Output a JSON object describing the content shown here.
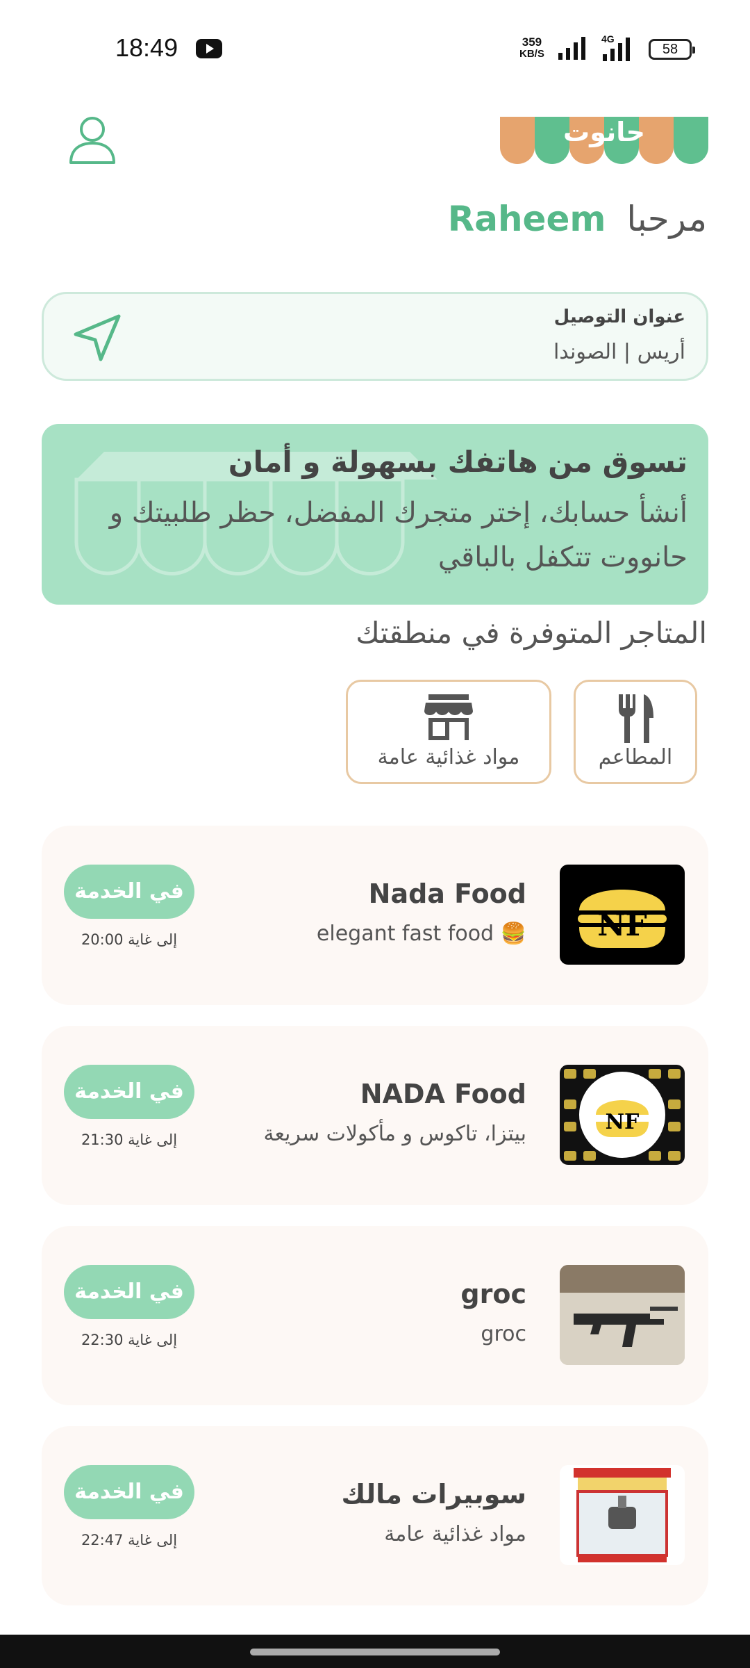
{
  "status_bar": {
    "time": "18:49",
    "speed_value": "359",
    "speed_unit": "KB/S",
    "network": "4G",
    "battery": "58"
  },
  "header": {
    "logo_text": "حانوت",
    "greeting_word": "مرحبا",
    "user_name": "Raheem"
  },
  "address": {
    "title": "عنوان التوصيل",
    "value": "أريس | الصوندا"
  },
  "banner": {
    "title": "تسوق من هاتفك بسهولة و أمان",
    "subtitle": "أنشأ حسابك، إختر متجرك المفضل، حظر طلبيتك و حانووت تتكفل بالباقي"
  },
  "section_title": "المتاجر المتوفرة في منطقتك",
  "categories": [
    {
      "label": "المطاعم",
      "icon": "fork-knife-icon"
    },
    {
      "label": "مواد غذائية عامة",
      "icon": "storefront-icon"
    }
  ],
  "stores": [
    {
      "name": "Nada Food",
      "description": "🍔 elegant fast food",
      "status": "في الخدمة",
      "hours": "إلى غاية 20:00",
      "thumb": "NF"
    },
    {
      "name": "NADA Food",
      "description": "بيتزا، تاكوس و مأكولات سريعة",
      "status": "في الخدمة",
      "hours": "إلى غاية 21:30",
      "thumb": "NF"
    },
    {
      "name": "groc",
      "description": "groc",
      "status": "في الخدمة",
      "hours": "إلى غاية 22:30",
      "thumb": ""
    },
    {
      "name": "سوبيرات مالك",
      "description": "مواد غذائية عامة",
      "status": "في الخدمة",
      "hours": "إلى غاية 22:47",
      "thumb": ""
    }
  ],
  "colors": {
    "accent": "#56b889",
    "badge": "#93d8b4",
    "banner": "#a7e1c4",
    "category_border": "#e8c9a3",
    "card_bg": "#fdf8f5"
  }
}
